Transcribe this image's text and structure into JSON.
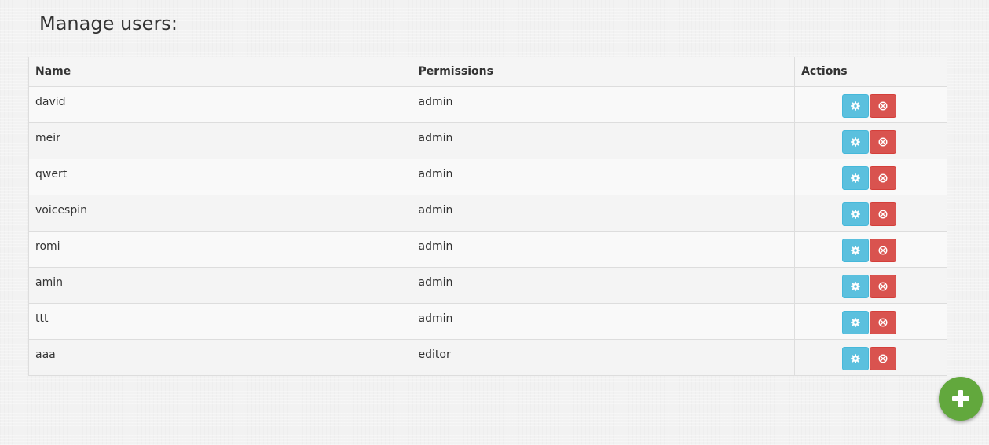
{
  "page": {
    "title": "Manage users:"
  },
  "table": {
    "columns": [
      "Name",
      "Permissions",
      "Actions"
    ],
    "rows": [
      {
        "name": "david",
        "permissions": "admin"
      },
      {
        "name": "meir",
        "permissions": "admin"
      },
      {
        "name": "qwert",
        "permissions": "admin"
      },
      {
        "name": "voicespin",
        "permissions": "admin"
      },
      {
        "name": "romi",
        "permissions": "admin"
      },
      {
        "name": "amin",
        "permissions": "admin"
      },
      {
        "name": "ttt",
        "permissions": "admin"
      },
      {
        "name": "aaa",
        "permissions": "editor"
      }
    ],
    "row_actions": {
      "edit_icon": "gear-icon",
      "delete_icon": "circle-x-icon"
    }
  },
  "fab": {
    "icon": "plus-icon"
  },
  "colors": {
    "edit_button": "#5bc0de",
    "delete_button": "#d9534f",
    "add_button": "#62a83d"
  }
}
